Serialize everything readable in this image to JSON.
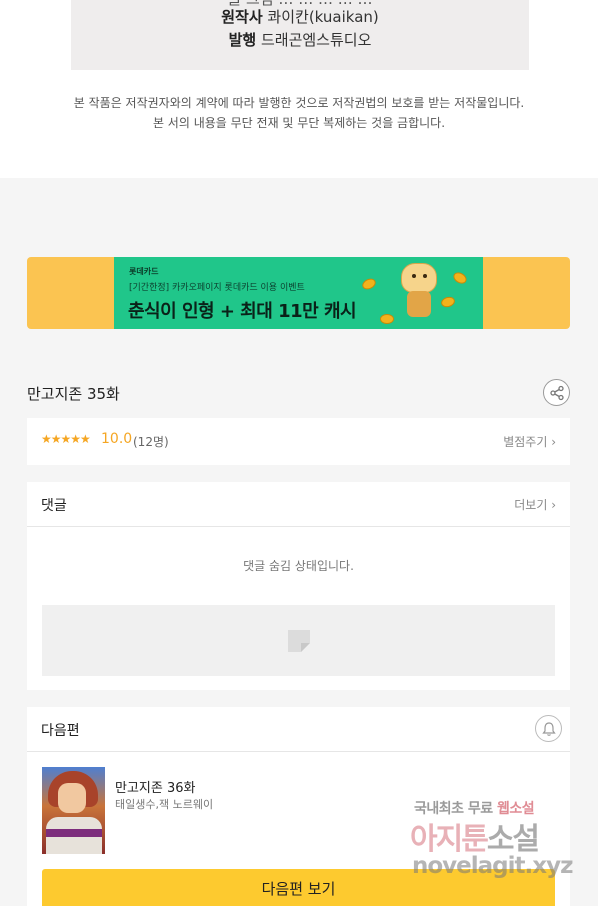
{
  "credits": {
    "cut_line": "글·그림 … … … … …",
    "original_label": "원작사",
    "original_value": "콰이칸(kuaikan)",
    "publisher_label": "발행",
    "publisher_value": "드래곤엠스튜디오"
  },
  "copyright": {
    "line1": "본 작품은 저작권자와의 계약에 따라 발행한 것으로 저작권법의 보호를 받는 저작물입니다.",
    "line2": "본 서의 내용을 무단 전재 및 무단 복제하는 것을 금합니다."
  },
  "banner": {
    "brand": "롯데카드",
    "subtitle": "[기간한정] 카카오페이지 롯데카드 이용 이벤트",
    "title": "춘식이 인형 + 최대 11만 캐시",
    "colors": {
      "outer": "#fbc451",
      "inner": "#20c68a"
    }
  },
  "episode": {
    "title": "만고지존 35화",
    "share_icon": "share-icon"
  },
  "rating": {
    "stars": "★★★★★",
    "score": "10.0",
    "count": "(12명)",
    "rate_link": "별점주기 ›"
  },
  "comments": {
    "title": "댓글",
    "more": "더보기 ›",
    "hidden_message": "댓글 숨김 상태입니다."
  },
  "next": {
    "header": "다음편",
    "bell_icon": "bell-icon",
    "title": "만고지존 36화",
    "author": "태일생수,잭 노르웨이",
    "button": "다음편 보기",
    "button_color": "#fdca2f"
  },
  "watermark": {
    "top_a": "국내최초 무료 ",
    "top_b": "웹소설",
    "mid_a": "아지툰",
    "mid_b": "소설",
    "url": "novelagit.xyz"
  }
}
